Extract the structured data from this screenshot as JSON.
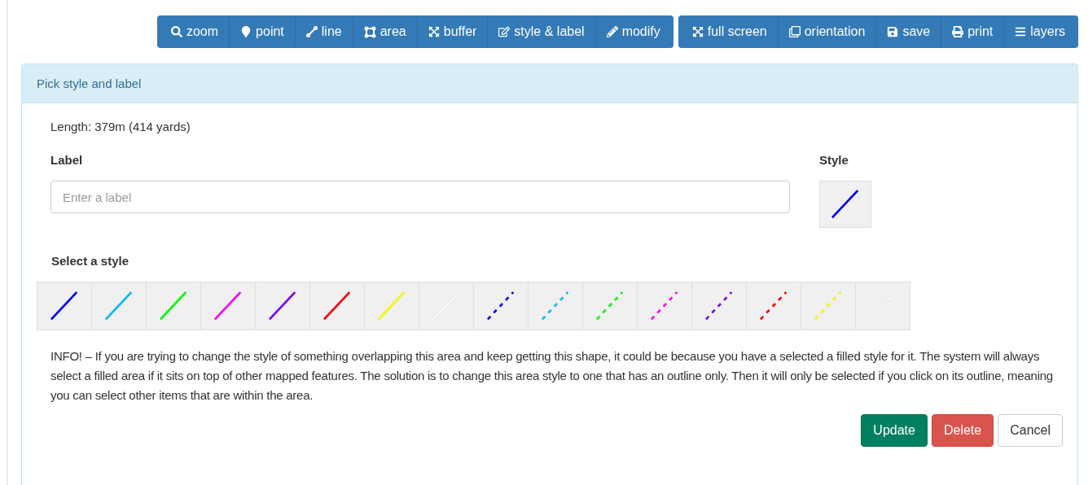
{
  "toolbar": {
    "groups": [
      [
        {
          "label": "zoom"
        },
        {
          "label": "point"
        },
        {
          "label": "line"
        },
        {
          "label": "area"
        },
        {
          "label": "buffer"
        },
        {
          "label": "style & label"
        },
        {
          "label": "modify"
        }
      ],
      [
        {
          "label": "full screen"
        },
        {
          "label": "orientation"
        },
        {
          "label": "save"
        },
        {
          "label": "print"
        },
        {
          "label": "layers"
        }
      ]
    ]
  },
  "panel": {
    "title": "Pick style and label",
    "length": "Length: 379m (414 yards)",
    "label_heading": "Label",
    "label_field": {
      "placeholder": "Enter a label"
    },
    "style_heading": "Style",
    "current_style": {
      "color": "#0000ff",
      "dashed": false
    },
    "select_heading": "Select a style",
    "styles": [
      {
        "color": "#0000ff",
        "dashed": false
      },
      {
        "color": "#00bfff",
        "dashed": false
      },
      {
        "color": "#00ff00",
        "dashed": false
      },
      {
        "color": "#ff00ff",
        "dashed": false
      },
      {
        "color": "#8000ff",
        "dashed": false
      },
      {
        "color": "#ff0000",
        "dashed": false
      },
      {
        "color": "#ffff00",
        "dashed": false
      },
      {
        "color": "#ffffff",
        "dashed": false
      },
      {
        "color": "#0000ff",
        "dashed": true
      },
      {
        "color": "#00bfff",
        "dashed": true
      },
      {
        "color": "#00ff00",
        "dashed": true
      },
      {
        "color": "#ff00ff",
        "dashed": true
      },
      {
        "color": "#8000ff",
        "dashed": true
      },
      {
        "color": "#ff0000",
        "dashed": true
      },
      {
        "color": "#ffff00",
        "dashed": true
      },
      {
        "color": "#ffffff",
        "dashed": true
      }
    ],
    "info": "INFO! – If you are trying to change the style of something overlapping this area and keep getting this shape, it could be because you have a selected a filled style for it. The system will always select a filled area if it sits on top of other mapped features. The solution is to change this area style to one that has an outline only. Then it will only be selected if you click on its outline, meaning you can select other items that are within the area.",
    "buttons": [
      {
        "kind": "success",
        "label": "Update"
      },
      {
        "kind": "danger",
        "label": "Delete"
      },
      {
        "kind": "default",
        "label": "Cancel"
      }
    ]
  }
}
